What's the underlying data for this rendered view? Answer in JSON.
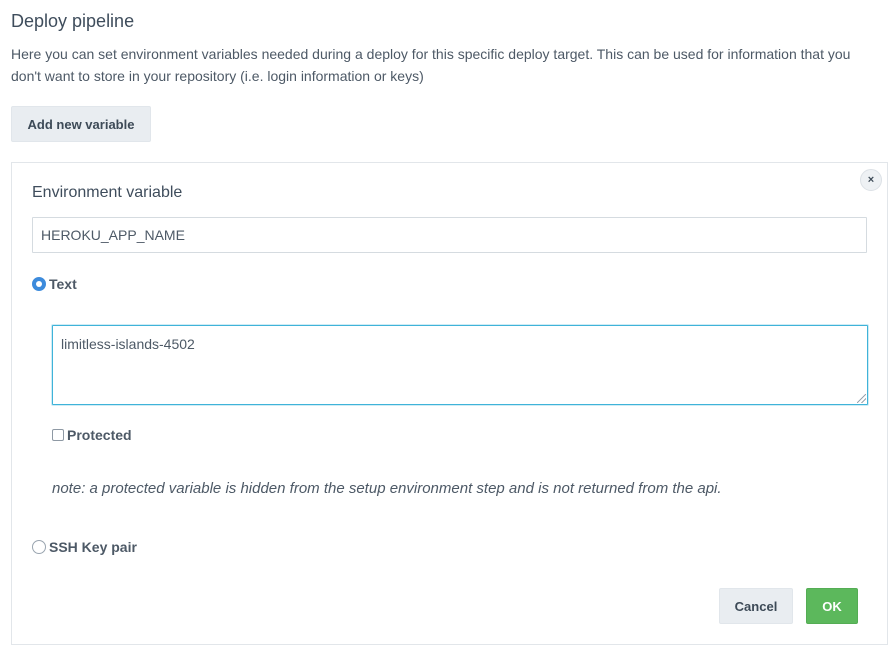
{
  "header": {
    "title": "Deploy pipeline",
    "description": "Here you can set environment variables needed during a deploy for this specific deploy target. This can be used for information that you don't want to store in your repository (i.e. login information or keys)",
    "add_button_label": "Add new variable"
  },
  "form": {
    "close_label": "×",
    "env_label": "Environment variable",
    "env_name_value": "HEROKU_APP_NAME",
    "type_options": [
      {
        "label": "Text",
        "checked": true
      },
      {
        "label": "SSH Key pair",
        "checked": false
      }
    ],
    "text_value": "limitless-islands-4502",
    "protected_label": "Protected",
    "protected_checked": false,
    "note": "note: a protected variable is hidden from the setup environment step and is not returned from the api.",
    "cancel_label": "Cancel",
    "ok_label": "OK"
  },
  "colors": {
    "accent": "#3d8bdc",
    "ok_green": "#5cb85c",
    "focus_border": "#3fb3d9"
  }
}
